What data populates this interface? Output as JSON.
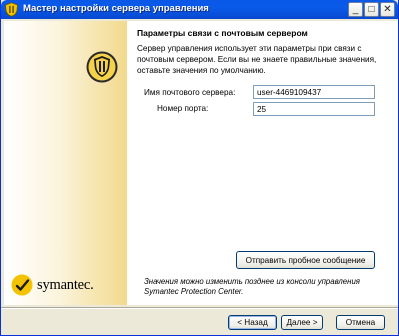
{
  "window": {
    "title": "Мастер настройки сервера управления",
    "controls": {
      "minimize": "_",
      "maximize": "□",
      "close": "✕"
    }
  },
  "left_panel": {
    "logo_text": "symantec.",
    "icons": [
      "shield-icon",
      "symantec-logo-icon"
    ],
    "gradient_colors": [
      "#ffffff",
      "#f2d98c"
    ]
  },
  "page": {
    "heading": "Параметры связи с почтовым сервером",
    "description": "Сервер управления использует эти параметры при связи с почтовым сервером.  Если вы не знаете правильные значения,\nоставьте значения по умолчанию.",
    "fields": {
      "server_label": "Имя почтового сервера:",
      "server_value": "user-4469109437",
      "port_label": "Номер порта:",
      "port_value": "25"
    },
    "test_button": "Отправить пробное сообщение",
    "note": "Значения можно изменить позднее из консоли управления\nSymantec Protection Center."
  },
  "footer": {
    "back": "< Назад",
    "next": "Далее >",
    "cancel": "Отмена"
  },
  "colors": {
    "titlebar": "#0a58e8",
    "window_bg": "#ece9d8",
    "button_border": "#003c74"
  }
}
